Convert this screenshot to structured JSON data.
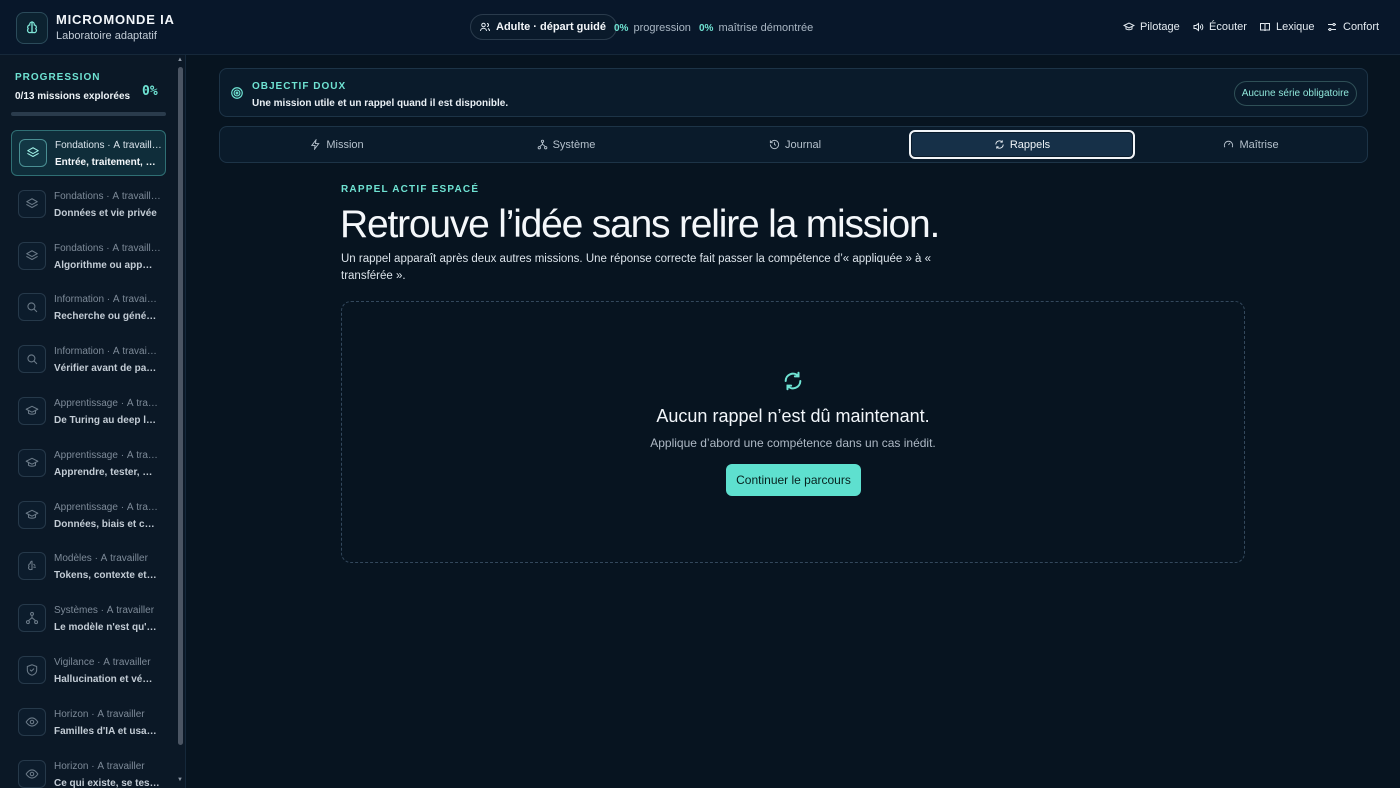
{
  "header": {
    "app_title": "MICROMONDE IA",
    "app_subtitle": "Laboratoire adaptatif",
    "profile": "Adulte · départ guidé",
    "progress_value": "0%",
    "progress_label": "progression",
    "mastery_value": "0%",
    "mastery_label": "maîtrise démontrée",
    "nav": [
      {
        "label": "Pilotage",
        "icon": "graduation-cap-icon"
      },
      {
        "label": "Écouter",
        "icon": "speaker-icon"
      },
      {
        "label": "Lexique",
        "icon": "book-icon"
      },
      {
        "label": "Confort",
        "icon": "sliders-icon"
      }
    ]
  },
  "sidebar": {
    "progress_title": "PROGRESSION",
    "progress_count": "0/13 missions explorées",
    "progress_percent": "0%",
    "progress_fraction": 0,
    "items": [
      {
        "top": "Fondations · À travaill…",
        "bottom": "Entrée, traitement, …",
        "icon": "layers-icon"
      },
      {
        "top": "Fondations · À travaill…",
        "bottom": "Données et vie privée",
        "icon": "layers-icon"
      },
      {
        "top": "Fondations · À travaill…",
        "bottom": "Algorithme ou app…",
        "icon": "layers-icon"
      },
      {
        "top": "Information · À travai…",
        "bottom": "Recherche ou géné…",
        "icon": "search-icon"
      },
      {
        "top": "Information · À travai…",
        "bottom": "Vérifier avant de pa…",
        "icon": "search-icon"
      },
      {
        "top": "Apprentissage · À tra…",
        "bottom": "De Turing au deep l…",
        "icon": "graduation-cap-icon"
      },
      {
        "top": "Apprentissage · À tra…",
        "bottom": "Apprendre, tester, …",
        "icon": "graduation-cap-icon"
      },
      {
        "top": "Apprentissage · À tra…",
        "bottom": "Données, biais et c…",
        "icon": "graduation-cap-icon"
      },
      {
        "top": "Modèles · À travailler",
        "bottom": "Tokens, contexte et…",
        "icon": "brain-icon"
      },
      {
        "top": "Systèmes · À travailler",
        "bottom": "Le modèle n'est qu'…",
        "icon": "network-icon"
      },
      {
        "top": "Vigilance · À travailler",
        "bottom": "Hallucination et vé…",
        "icon": "shield-icon"
      },
      {
        "top": "Horizon · À travailler",
        "bottom": "Familles d'IA et usa…",
        "icon": "eye-icon"
      },
      {
        "top": "Horizon · À travailler",
        "bottom": "Ce qui existe, se tes…",
        "icon": "eye-icon"
      }
    ]
  },
  "objective": {
    "title": "OBJECTIF DOUX",
    "description": "Une mission utile et un rappel quand il est disponible.",
    "badge": "Aucune série obligatoire"
  },
  "tabs": [
    {
      "label": "Mission",
      "icon": "lightning-icon"
    },
    {
      "label": "Système",
      "icon": "network-icon"
    },
    {
      "label": "Journal",
      "icon": "history-icon"
    },
    {
      "label": "Rappels",
      "icon": "refresh-icon",
      "active": true
    },
    {
      "label": "Maîtrise",
      "icon": "gauge-icon"
    }
  ],
  "content": {
    "eyebrow": "RAPPEL ACTIF ESPACÉ",
    "headline": "Retrouve l’idée sans relire la mission.",
    "lead": "Un rappel apparaît après deux autres missions. Une réponse correcte fait passer la compétence d’« appliquée » à « transférée ».",
    "empty_title": "Aucun rappel n’est dû maintenant.",
    "empty_subtitle": "Applique d’abord une compétence dans un cas inédit.",
    "cta": "Continuer le parcours"
  },
  "colors": {
    "accent": "#6fe3d3",
    "button": "#5ee0cf",
    "background": "#071420"
  }
}
